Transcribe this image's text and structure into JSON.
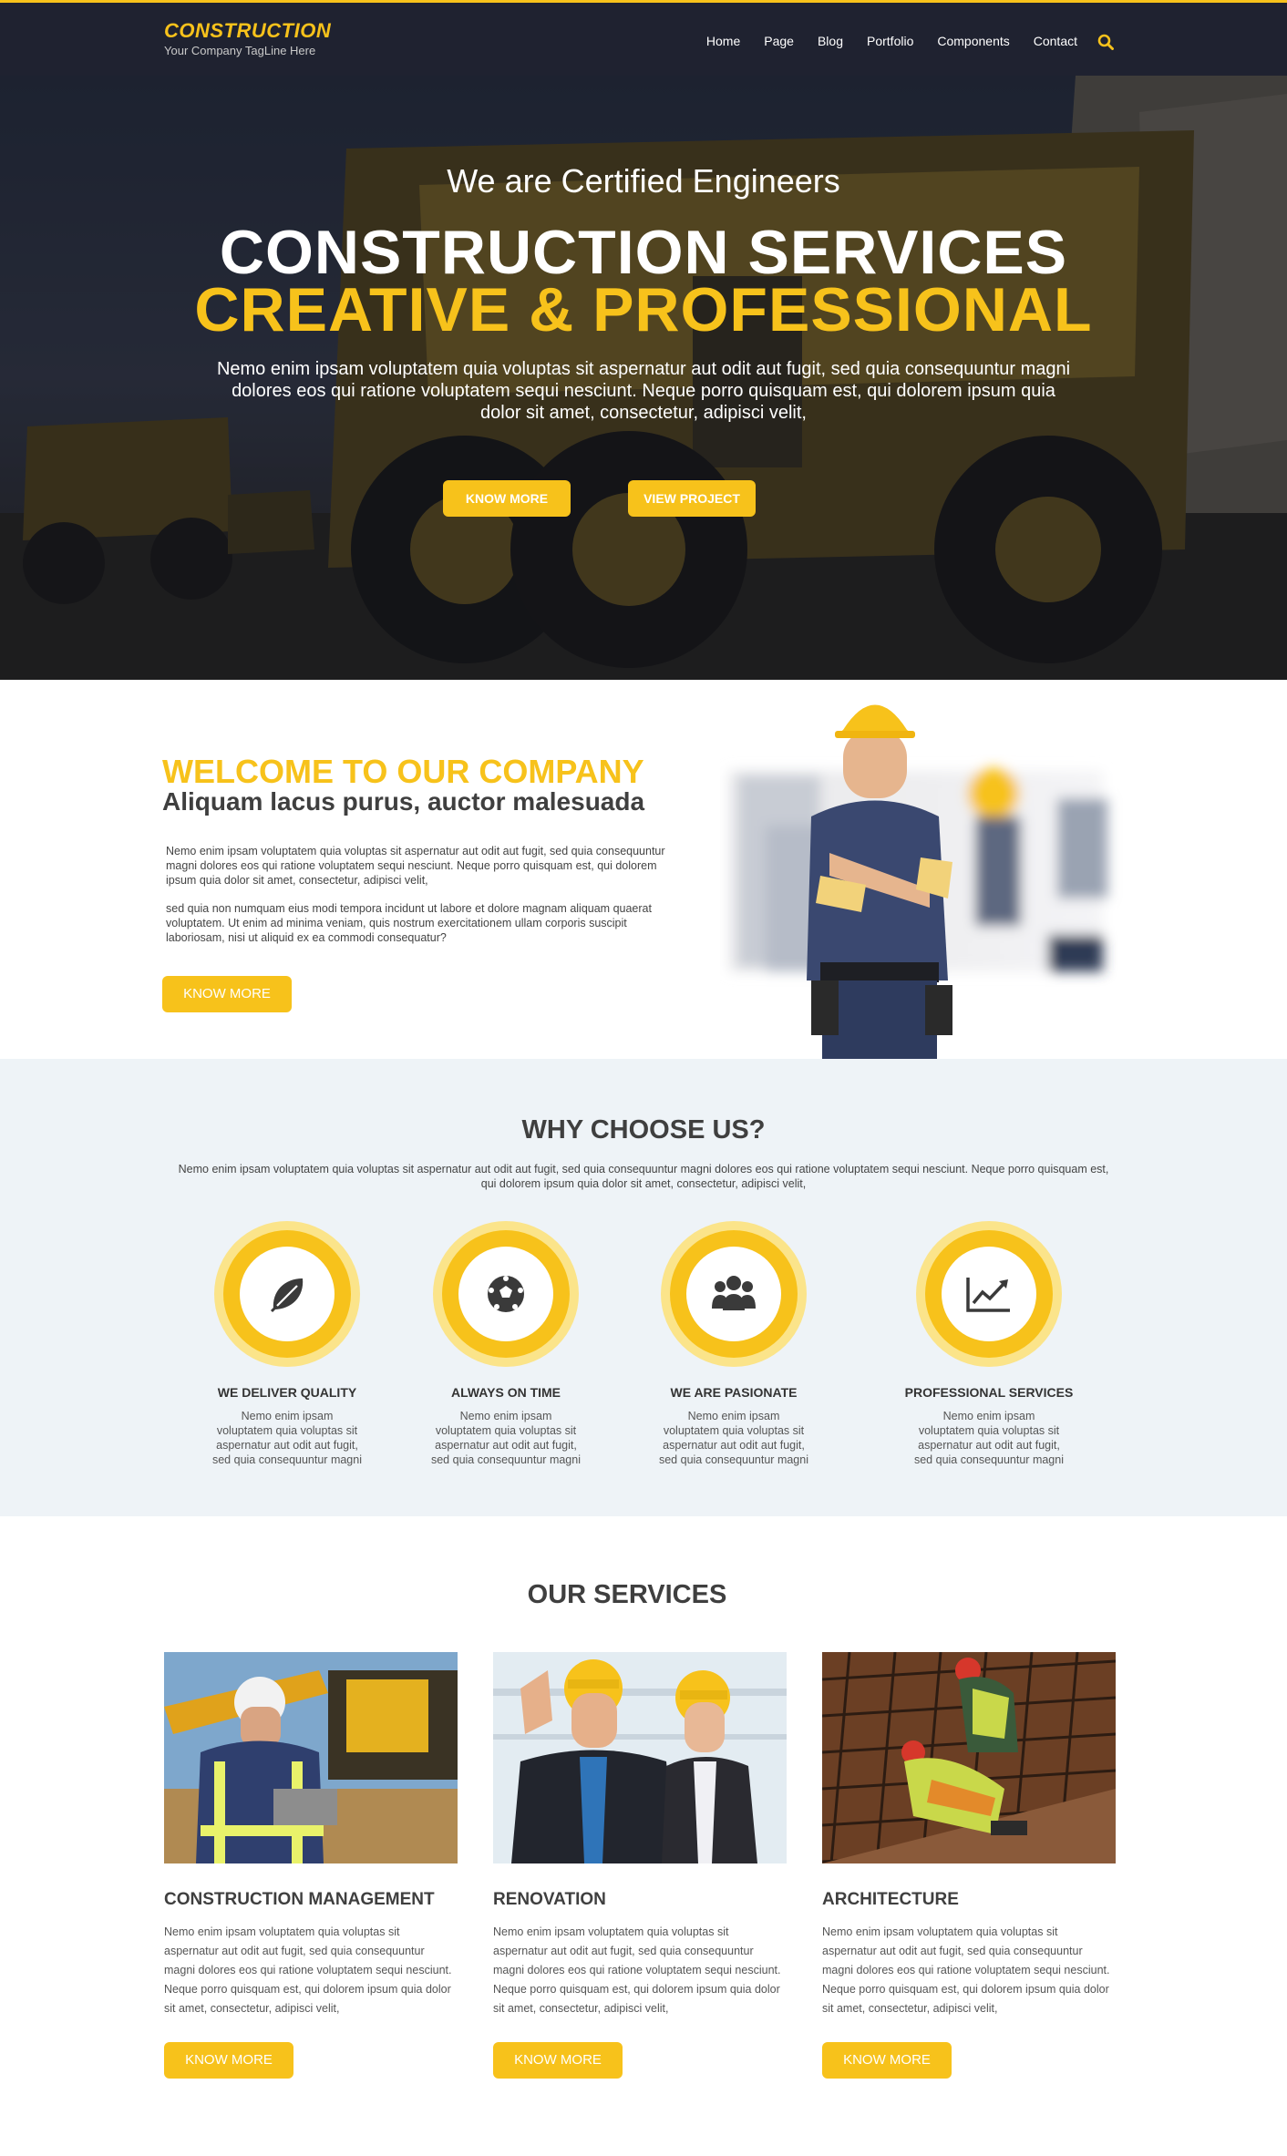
{
  "brand": {
    "name": "CONSTRUCTION",
    "tagline": "Your Company TagLine Here",
    "accent_color": "#f7c21b",
    "header_bg": "#1f2230"
  },
  "nav": {
    "items": [
      "Home",
      "Page",
      "Blog",
      "Portfolio",
      "Components",
      "Contact"
    ],
    "search_icon": "search-icon"
  },
  "hero": {
    "subtitle": "We are Certified Engineers",
    "title_line1": "CONSTRUCTION SERVICES",
    "title_line2": "CREATIVE & PROFESSIONAL",
    "text": "Nemo enim ipsam voluptatem quia voluptas sit aspernatur aut odit aut fugit, sed quia consequuntur magni dolores eos qui ratione voluptatem sequi nesciunt. Neque porro quisquam est, qui dolorem ipsum quia dolor sit amet, consectetur, adipisci velit,",
    "button_know_more": "KNOW MORE",
    "button_view_project": "VIEW PROJECT"
  },
  "welcome": {
    "title": "WELCOME TO OUR COMPANY",
    "subtitle": "Aliquam lacus purus, auctor malesuada",
    "paragraph1": "Nemo enim ipsam voluptatem quia voluptas sit aspernatur aut odit aut fugit, sed quia consequuntur magni dolores eos qui ratione voluptatem sequi nesciunt. Neque porro quisquam est, qui dolorem ipsum quia dolor sit amet, consectetur, adipisci velit,",
    "paragraph2": "sed quia non numquam eius modi tempora incidunt ut labore et dolore magnam aliquam quaerat voluptatem. Ut enim ad minima veniam, quis nostrum exercitationem ullam corporis suscipit laboriosam, nisi ut aliquid ex ea commodi consequatur?",
    "button": "KNOW MORE"
  },
  "why": {
    "title": "WHY CHOOSE US?",
    "text": "Nemo enim ipsam voluptatem quia voluptas sit aspernatur aut odit aut fugit, sed quia consequuntur magni dolores eos qui ratione voluptatem sequi nesciunt. Neque porro quisquam est, qui dolorem ipsum quia dolor sit amet, consectetur, adipisci velit,",
    "features": [
      {
        "title": "WE DELIVER QUALITY",
        "icon": "leaf-icon",
        "text": "Nemo enim ipsam voluptatem quia voluptas sit aspernatur aut odit aut fugit, sed quia consequuntur magni"
      },
      {
        "title": "ALWAYS ON TIME",
        "icon": "soccer-ball-icon",
        "text": "Nemo enim ipsam voluptatem quia voluptas sit aspernatur aut odit aut fugit, sed quia consequuntur magni"
      },
      {
        "title": "WE ARE PASIONATE",
        "icon": "users-group-icon",
        "text": "Nemo enim ipsam voluptatem quia voluptas sit aspernatur aut odit aut fugit, sed quia consequuntur magni"
      },
      {
        "title": "PROFESSIONAL SERVICES",
        "icon": "chart-trend-icon",
        "text": "Nemo enim ipsam voluptatem quia voluptas sit aspernatur aut odit aut fugit, sed quia consequuntur magni"
      }
    ]
  },
  "services": {
    "title": "OUR SERVICES",
    "items": [
      {
        "title": "CONSTRUCTION MANAGEMENT",
        "text": "Nemo enim ipsam voluptatem quia voluptas sit aspernatur aut odit aut fugit, sed quia consequuntur magni dolores eos qui ratione voluptatem sequi nesciunt. Neque porro quisquam est, qui dolorem ipsum quia dolor sit amet, consectetur, adipisci velit,",
        "button": "KNOW MORE"
      },
      {
        "title": "RENOVATION",
        "text": "Nemo enim ipsam voluptatem quia voluptas sit aspernatur aut odit aut fugit, sed quia consequuntur magni dolores eos qui ratione voluptatem sequi nesciunt. Neque porro quisquam est, qui dolorem ipsum quia dolor sit amet, consectetur, adipisci velit,",
        "button": "KNOW MORE"
      },
      {
        "title": "ARCHITECTURE",
        "text": "Nemo enim ipsam voluptatem quia voluptas sit aspernatur aut odit aut fugit, sed quia consequuntur magni dolores eos qui ratione voluptatem sequi nesciunt. Neque porro quisquam est, qui dolorem ipsum quia dolor sit amet, consectetur, adipisci velit,",
        "button": "KNOW MORE"
      }
    ]
  }
}
